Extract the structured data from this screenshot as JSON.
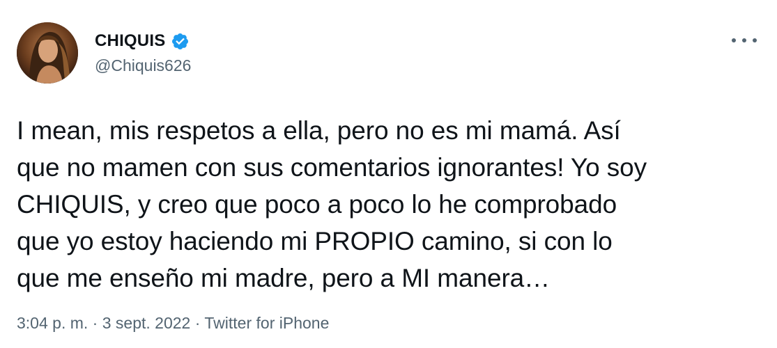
{
  "author": {
    "display_name": "CHIQUIS",
    "handle": "@Chiquis626",
    "verified_icon": "verified-badge-icon",
    "avatar_icon": "profile-photo"
  },
  "menu": {
    "icon": "more-horizontal-icon"
  },
  "tweet": {
    "lines": [
      "I mean, mis respetos a ella, pero no es mi mamá. Así",
      "que no mamen con sus comentarios ignorantes! Yo soy",
      "CHIQUIS, y creo que poco a poco lo he comprobado",
      "que yo estoy haciendo mi PROPIO camino, si con lo",
      "que me enseño mi madre, pero a MI manera…"
    ]
  },
  "meta": {
    "time": "3:04 p. m.",
    "separator": "·",
    "date": "3 sept. 2022",
    "source": "Twitter for iPhone"
  },
  "colors": {
    "text": "#0f1419",
    "secondary": "#536471",
    "verified": "#1d9bf0",
    "background": "#ffffff"
  }
}
